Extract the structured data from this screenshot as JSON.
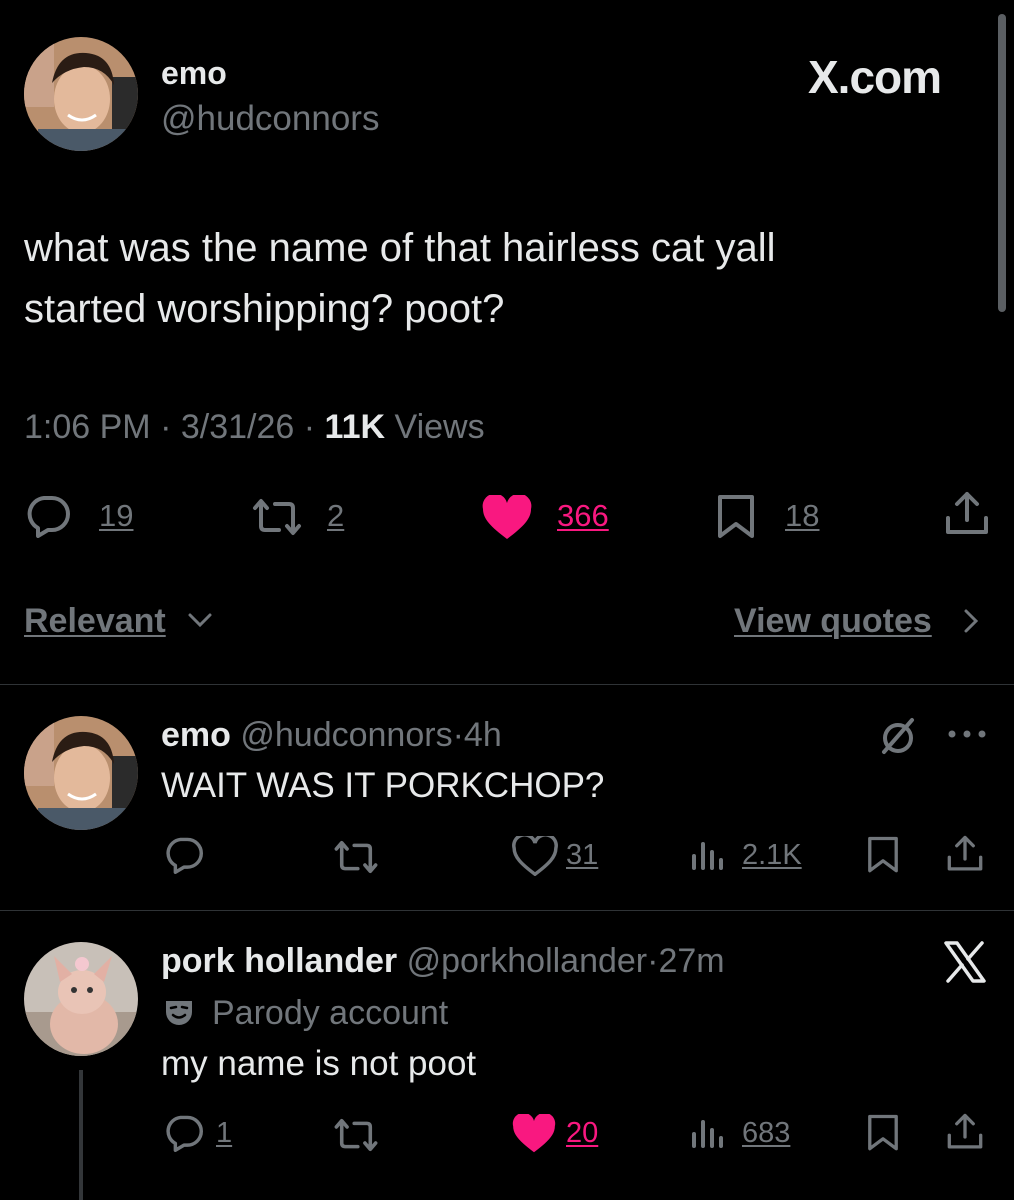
{
  "header": {
    "brand": "X.com"
  },
  "main_post": {
    "display_name": "emo",
    "handle": "@hudconnors",
    "text_line1": "what was the name of that hairless cat yall",
    "text_line2": "started worshipping? poot?",
    "time": "1:06 PM",
    "date": "3/31/26",
    "views_count": "11K",
    "views_label": "Views",
    "sep": "·",
    "replies": "19",
    "reposts": "2",
    "likes": "366",
    "bookmarks": "18",
    "liked": true
  },
  "controls": {
    "sort_label": "Relevant",
    "quotes_label": "View quotes"
  },
  "replies": [
    {
      "display_name": "emo",
      "handle": "@hudconnors",
      "time": "4h",
      "text": "WAIT WAS IT PORKCHOP?",
      "replies": "",
      "reposts": "",
      "likes": "31",
      "views": "2.1K",
      "liked": false
    },
    {
      "display_name": "pork hollander",
      "handle": "@porkhollander",
      "time": "27m",
      "label": "Parody account",
      "text": "my name is not poot",
      "replies": "1",
      "reposts": "",
      "likes": "20",
      "views": "683",
      "liked": true
    }
  ],
  "colors": {
    "background": "#000000",
    "text": "#e7e9ea",
    "secondary": "#71767b",
    "like_pink": "#f91880",
    "divider": "#2f3336"
  },
  "icons": [
    "reply-icon",
    "repost-icon",
    "heart-icon",
    "bookmark-icon",
    "share-icon",
    "views-icon",
    "more-icon",
    "x-logo-icon",
    "grok-icon",
    "parody-mask-icon",
    "chevron-down-icon",
    "chevron-right-icon"
  ]
}
